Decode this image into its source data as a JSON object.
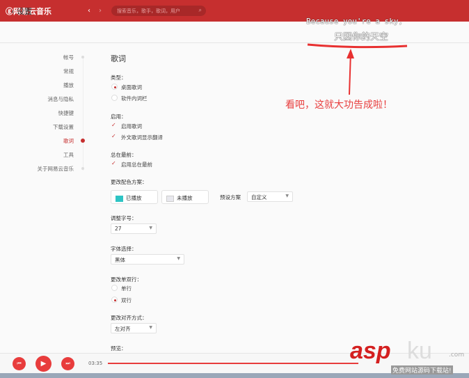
{
  "header": {
    "app_name": "网易云音乐",
    "back": "‹",
    "forward": "›",
    "search_placeholder": "搜索音乐，歌手，歌词，用户"
  },
  "subheader": {
    "title": "设置"
  },
  "sidebar": {
    "items": [
      {
        "label": "帐号"
      },
      {
        "label": "常规"
      },
      {
        "label": "播放"
      },
      {
        "label": "消息与隐私"
      },
      {
        "label": "快捷键"
      },
      {
        "label": "下载设置"
      },
      {
        "label": "歌词",
        "active": true
      },
      {
        "label": "工具"
      },
      {
        "label": "关于网易云音乐"
      }
    ]
  },
  "lyrics": {
    "title": "歌词",
    "type_label": "类型：",
    "type_options": [
      "桌面歌词",
      "软件内词栏"
    ],
    "enable_label": "启用：",
    "enable_options": [
      "启用歌词",
      "外文歌词显示翻译"
    ],
    "ontop_label": "总在最前：",
    "ontop_option": "启用总在最前",
    "color_label": "更改配色方案：",
    "played": "已播放",
    "unplayed": "未播放",
    "preset_label": "预设方案",
    "preset_value": "自定义",
    "font_size_label": "调整字号：",
    "font_size_value": "27",
    "font_label": "字体选择：",
    "font_value": "黑体",
    "lines_label": "更改单双行：",
    "lines_options": [
      "单行",
      "双行"
    ],
    "align_label": "更改对齐方式：",
    "align_value": "左对齐",
    "preview_label": "预览："
  },
  "player": {
    "time": "03:35",
    "progress": 0.0
  },
  "annotation": {
    "lyric_en": "Because you're a sky,",
    "lyric_zh": "只因你的天空",
    "note": "看吧，这就大功告成啦！"
  },
  "watermark": {
    "brand_a": "asp",
    "brand_b": "ku",
    "domain": ".com",
    "slogan": "免费网站源码下载站!"
  },
  "colors": {
    "accent": "#c62f2f",
    "played": "#2ec4c4",
    "unplayed": "#e8e8ee"
  }
}
